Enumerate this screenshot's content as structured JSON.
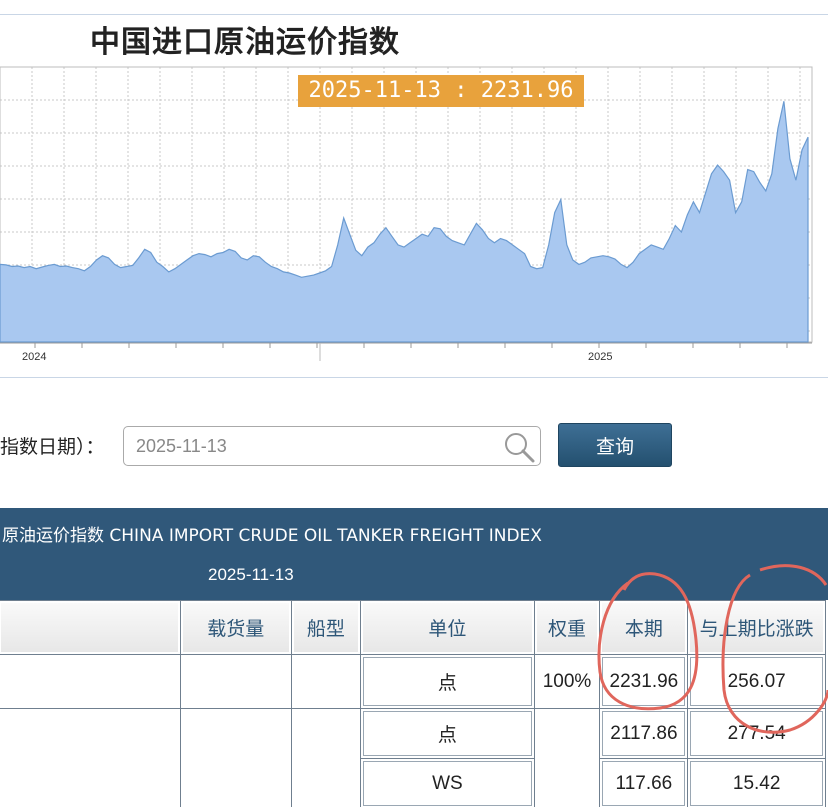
{
  "chart": {
    "title": "中国进口原油运价指数",
    "tooltip": "2025-11-13 : 2231.96",
    "x_tick_labels": [
      "2024",
      "2025"
    ]
  },
  "chart_data": {
    "type": "area",
    "title": "中国进口原油运价指数",
    "x_labels": [
      "2024",
      "2025"
    ],
    "highlight": {
      "date": "2025-11-13",
      "value": 2231.96
    },
    "series": [
      {
        "values": [
          720,
          715,
          700,
          705,
          690,
          700,
          680,
          695,
          710,
          720,
          700,
          705,
          690,
          680,
          660,
          700,
          760,
          800,
          780,
          720,
          690,
          700,
          710,
          780,
          860,
          830,
          740,
          700,
          650,
          680,
          720,
          760,
          800,
          820,
          810,
          790,
          820,
          830,
          860,
          840,
          780,
          760,
          800,
          790,
          740,
          700,
          680,
          650,
          640,
          620,
          600,
          610,
          620,
          640,
          660,
          700,
          900,
          1150,
          1000,
          850,
          800,
          880,
          920,
          1000,
          1060,
          980,
          900,
          880,
          920,
          960,
          1000,
          980,
          1060,
          1050,
          980,
          940,
          920,
          900,
          1000,
          1100,
          1040,
          960,
          920,
          960,
          940,
          900,
          860,
          820,
          700,
          680,
          690,
          900,
          1200,
          1320,
          900,
          760,
          720,
          740,
          780,
          790,
          800,
          790,
          770,
          720,
          690,
          740,
          820,
          860,
          900,
          880,
          860,
          960,
          1080,
          1020,
          1180,
          1300,
          1200,
          1380,
          1560,
          1640,
          1580,
          1500,
          1200,
          1300,
          1600,
          1580,
          1480,
          1400,
          1560,
          1980,
          2231.96,
          1700,
          1500,
          1780,
          1900
        ]
      }
    ]
  },
  "query": {
    "label": "指数日期）：",
    "date_value": "2025-11-13",
    "button_label": "查询"
  },
  "table": {
    "title": "原油运价指数 CHINA IMPORT CRUDE OIL TANKER FREIGHT INDEX",
    "date": "2025-11-13",
    "headers": [
      "载货量",
      "船型",
      "单位",
      "权重",
      "本期",
      "与上期比涨跌"
    ],
    "rows": [
      {
        "name": "",
        "load": "",
        "ship": "",
        "unit": "点",
        "weight": "100%",
        "current": "2231.96",
        "change": "256.07"
      },
      {
        "name": "",
        "load": "",
        "ship": "",
        "unit": "点",
        "weight": "",
        "current": "2117.86",
        "change": "277.54"
      },
      {
        "name": "",
        "load": "",
        "ship": "",
        "unit": "WS",
        "weight": "",
        "current": "117.66",
        "change": "15.42"
      }
    ]
  },
  "colors": {
    "area_fill": "#a9c8f0",
    "area_line": "#6b9bd1",
    "tooltip_bg": "#e8a23c",
    "table_header_bg": "#30587a",
    "query_button": "#2f5e82",
    "annotation": "#e0665c"
  }
}
